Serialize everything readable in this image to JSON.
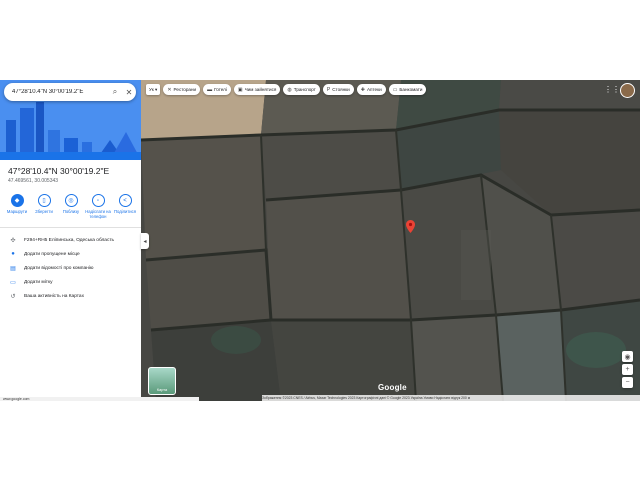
{
  "search": {
    "query": "47°28'10.4\"N 30°00'19.2\"E"
  },
  "place": {
    "title": "47°28'10.4\"N 30°00'19.2\"E",
    "latlng": "47.469561, 30.005343"
  },
  "actions": [
    {
      "label": "Маршрути",
      "icon": "directions-icon"
    },
    {
      "label": "Зберегти",
      "icon": "bookmark-icon"
    },
    {
      "label": "Поблизу",
      "icon": "nearby-icon"
    },
    {
      "label": "Надіслати на телефон",
      "icon": "send-to-phone-icon"
    },
    {
      "label": "Поділитися",
      "icon": "share-icon"
    }
  ],
  "info": [
    {
      "text": "F294+RH5 Еліпинська, Одеська область",
      "icon": "plus-code-icon"
    },
    {
      "text": "Додати пропущене місце",
      "icon": "add-place-icon"
    },
    {
      "text": "Додати відомості про компанію",
      "icon": "add-business-icon"
    },
    {
      "text": "Додати мітку",
      "icon": "label-icon"
    },
    {
      "text": "Ваша активність на Картах",
      "icon": "history-icon"
    }
  ],
  "chips": [
    {
      "label": "Ресторани",
      "icon": "fork-knife-icon"
    },
    {
      "label": "Готелі",
      "icon": "bed-icon"
    },
    {
      "label": "Чим зайнятися",
      "icon": "camera-icon"
    },
    {
      "label": "Транспорт",
      "icon": "transit-icon"
    },
    {
      "label": "Стоянки",
      "icon": "parking-icon"
    },
    {
      "label": "Аптеки",
      "icon": "pharmacy-icon"
    },
    {
      "label": "Банкомати",
      "icon": "atm-icon"
    }
  ],
  "lang_chip": "Ук",
  "layer": {
    "label": "Карта"
  },
  "status_url": "www.google.com",
  "logo": "Google",
  "attribution": "Зображення ©2023 CNES / Airbus, Maxar Technologies 2023  Картографічні дані © Google 2023   Україна   Умови   Надіслати відгук   200 м"
}
